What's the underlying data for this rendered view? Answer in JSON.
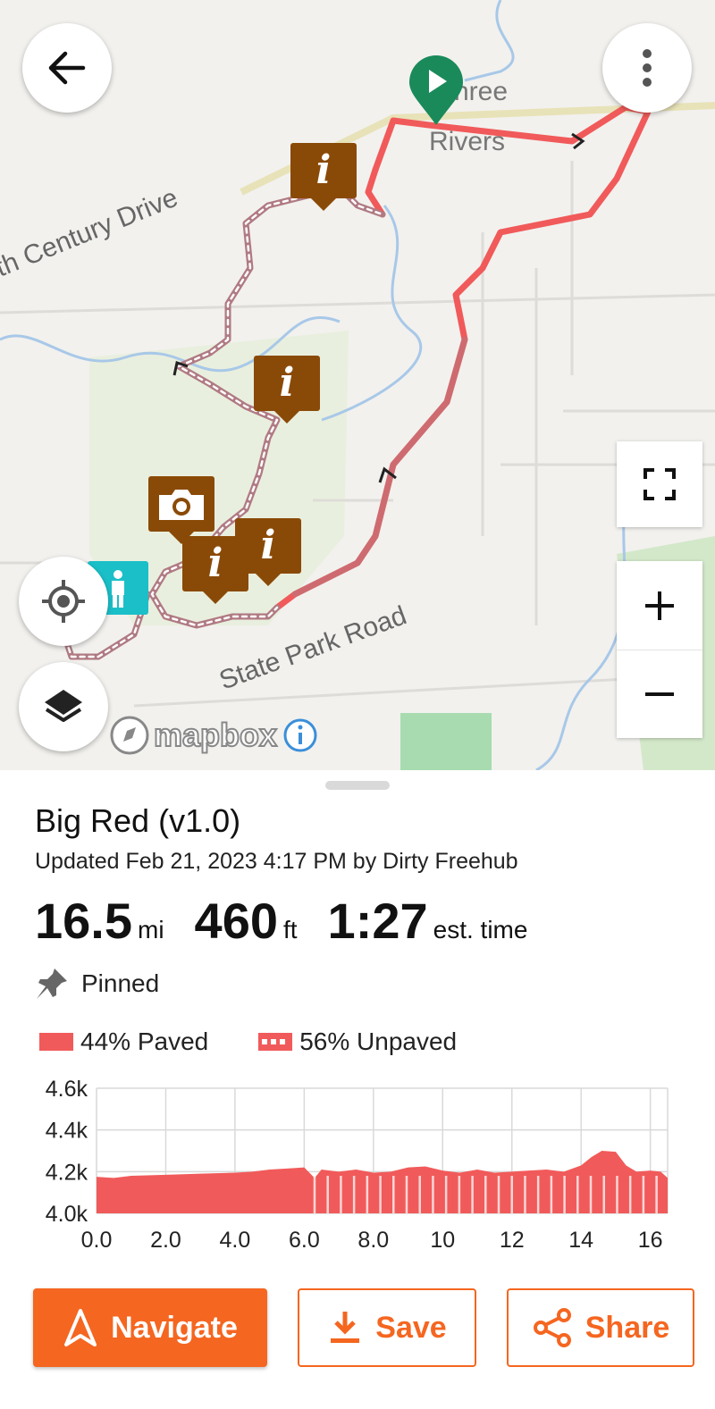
{
  "map": {
    "labels": {
      "road_1": "th Century Drive",
      "road_2": "State Park Road",
      "town": "Three Rivers",
      "town_line1": "hree",
      "town_line2": "Rivers"
    },
    "attribution": "mapbox",
    "controls": [
      "back-arrow-icon",
      "more-vertical-icon",
      "fullscreen-icon",
      "zoom-in-icon",
      "zoom-out-icon",
      "my-location-icon",
      "layers-icon"
    ],
    "colors": {
      "route_paved": "#f15a5a",
      "route_unpaved": "#b07a83",
      "poi": "#8a4a07",
      "start": "#1a8a5a",
      "accent": "#f56620"
    }
  },
  "route": {
    "title": "Big Red (v1.0)",
    "updated": "Updated Feb 21, 2023 4:17 PM by Dirty Freehub",
    "distance_value": "16.5",
    "distance_unit": "mi",
    "elevation_value": "460",
    "elevation_unit": "ft",
    "time_value": "1:27",
    "time_unit": "est. time",
    "pinned_label": "Pinned"
  },
  "surface": {
    "paved_label": "44% Paved",
    "unpaved_label": "56% Unpaved",
    "paved_pct": 44,
    "unpaved_pct": 56
  },
  "chart_data": {
    "type": "area",
    "title": "",
    "xlabel": "",
    "ylabel": "",
    "xlim": [
      0,
      16.5
    ],
    "ylim": [
      4000,
      4600
    ],
    "yticks": [
      {
        "v": 4000,
        "label": "4.0k"
      },
      {
        "v": 4200,
        "label": "4.2k"
      },
      {
        "v": 4400,
        "label": "4.4k"
      },
      {
        "v": 4600,
        "label": "4.6k"
      }
    ],
    "xticks": [
      {
        "v": 0,
        "label": "0.0"
      },
      {
        "v": 2,
        "label": "2.0"
      },
      {
        "v": 4,
        "label": "4.0"
      },
      {
        "v": 6,
        "label": "6.0"
      },
      {
        "v": 8,
        "label": "8.0"
      },
      {
        "v": 10,
        "label": "10"
      },
      {
        "v": 12,
        "label": "12"
      },
      {
        "v": 14,
        "label": "14"
      },
      {
        "v": 16,
        "label": "16"
      }
    ],
    "x": [
      0,
      0.5,
      1,
      2,
      3,
      4,
      4.5,
      5,
      5.5,
      6,
      6.3,
      6.5,
      7,
      7.5,
      8,
      8.5,
      9,
      9.5,
      10,
      10.5,
      11,
      11.5,
      12,
      12.5,
      13,
      13.5,
      14,
      14.3,
      14.6,
      15,
      15.3,
      15.6,
      16,
      16.3,
      16.5
    ],
    "y": [
      4175,
      4170,
      4180,
      4185,
      4190,
      4195,
      4200,
      4210,
      4215,
      4220,
      4170,
      4210,
      4200,
      4210,
      4195,
      4200,
      4220,
      4225,
      4205,
      4195,
      4210,
      4195,
      4200,
      4205,
      4210,
      4200,
      4230,
      4270,
      4300,
      4295,
      4230,
      4200,
      4205,
      4200,
      4170
    ],
    "unpaved_from": 6.3,
    "grid": true
  },
  "actions": {
    "navigate": "Navigate",
    "save": "Save",
    "share": "Share"
  }
}
